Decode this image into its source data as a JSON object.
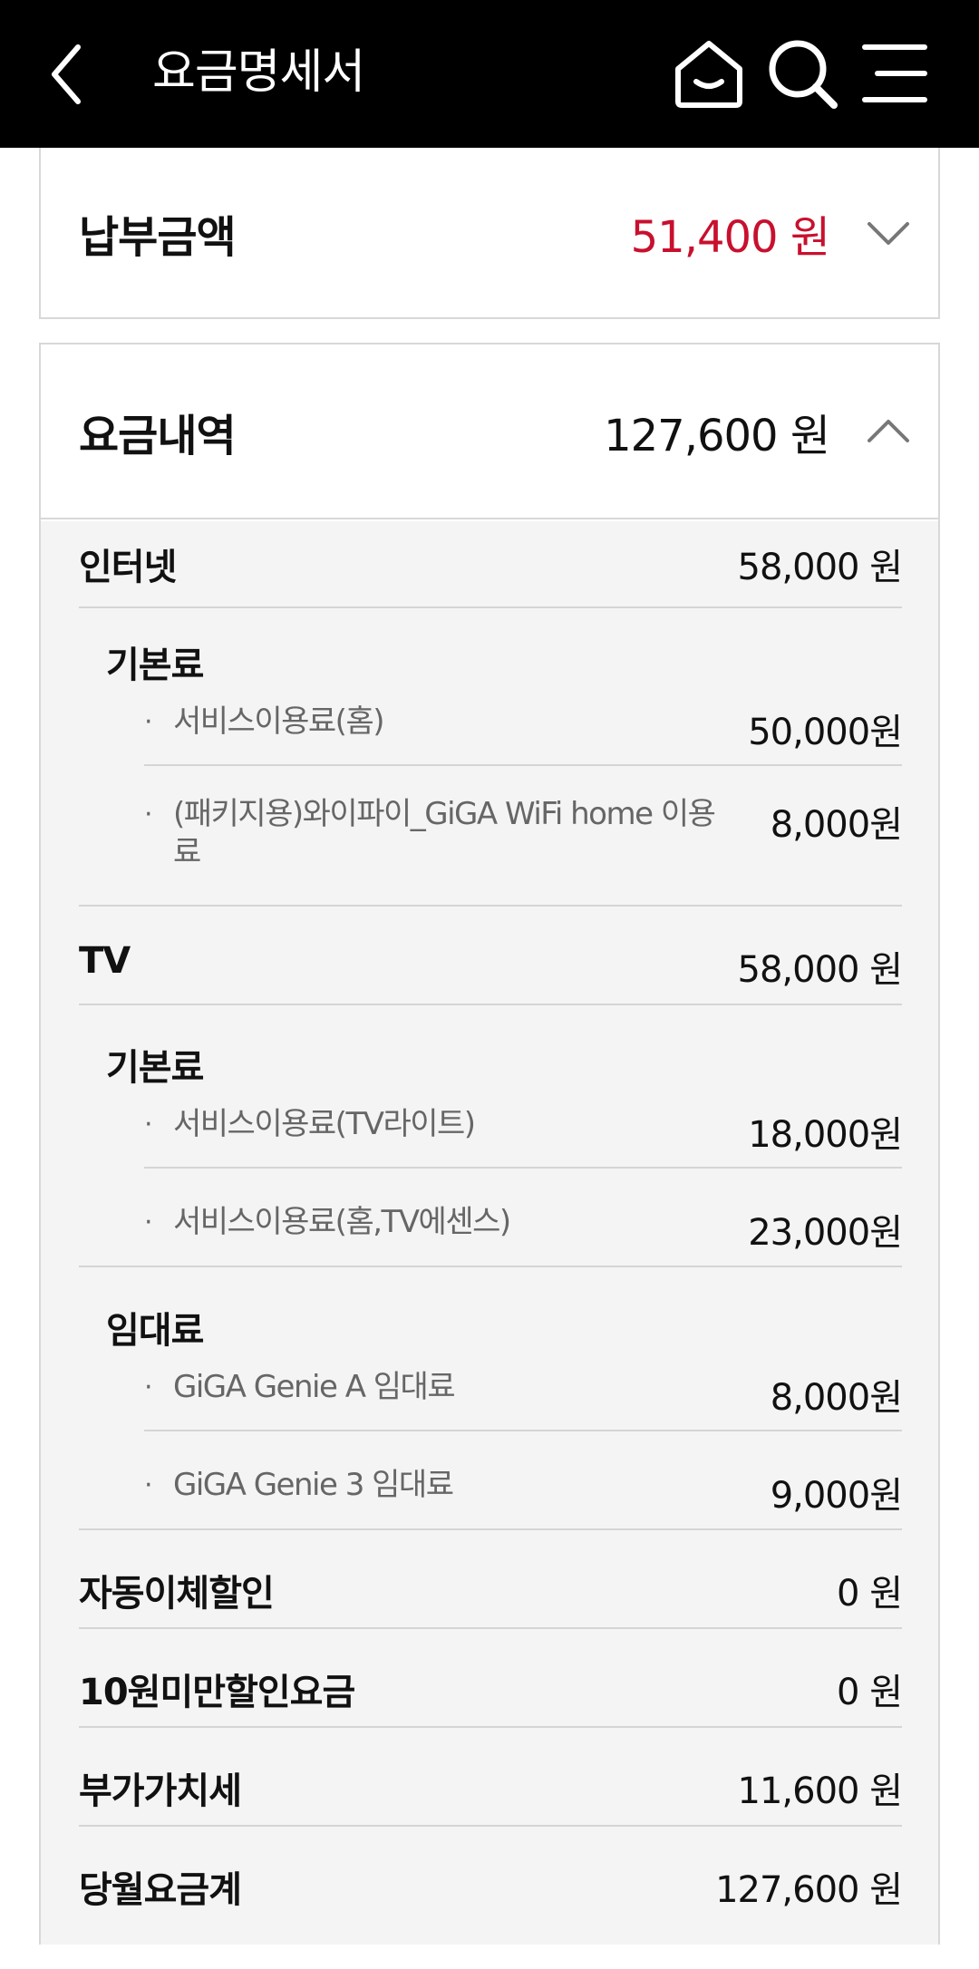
{
  "header": {
    "title": "요금명세서",
    "icons": [
      "back-arrow-icon",
      "home-icon",
      "search-icon",
      "menu-icon"
    ]
  },
  "payment": {
    "label": "납부금액",
    "amount": "51,400 원",
    "amount_color": "#c8102e"
  },
  "bill": {
    "label": "요금내역",
    "amount": "127,600 원",
    "internet": {
      "label": "인터넷",
      "amount": "58,000 원",
      "basic_label": "기본료",
      "items": [
        {
          "name": "서비스이용료(홈)",
          "amount": "50,000원"
        },
        {
          "name": "(패키지용)와이파이_GiGA WiFi home 이용료",
          "amount": "8,000원"
        }
      ]
    },
    "tv": {
      "label": "TV",
      "amount": "58,000 원",
      "basic_label": "기본료",
      "basic_items": [
        {
          "name": "서비스이용료(TV라이트)",
          "amount": "18,000원"
        },
        {
          "name": "서비스이용료(홈,TV에센스)",
          "amount": "23,000원"
        }
      ],
      "rental_label": "임대료",
      "rental_items": [
        {
          "name": "GiGA Genie A 임대료",
          "amount": "8,000원"
        },
        {
          "name": "GiGA Genie 3 임대료",
          "amount": "9,000원"
        }
      ]
    },
    "auto_transfer_discount": {
      "label": "자동이체할인",
      "amount": "0 원"
    },
    "under10_discount": {
      "label": "10원미만할인요금",
      "amount": "0 원"
    },
    "vat": {
      "label": "부가가치세",
      "amount": "11,600 원"
    },
    "monthly_total": {
      "label": "당월요금계",
      "amount": "127,600 원"
    }
  }
}
